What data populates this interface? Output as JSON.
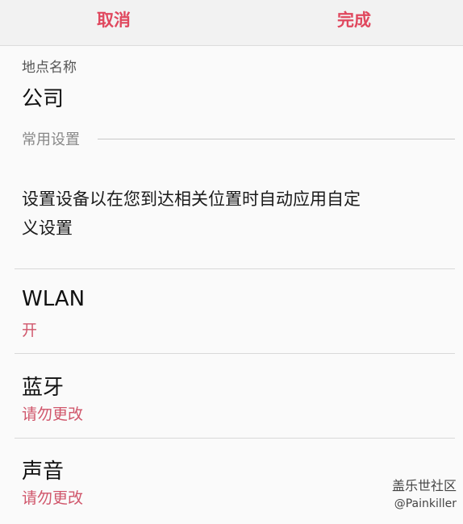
{
  "topbar": {
    "cancel_label": "取消",
    "done_label": "完成"
  },
  "location": {
    "label": "地点名称",
    "value": "公司"
  },
  "section": {
    "title": "常用设置"
  },
  "description": "设置设备以在您到达相关位置时自动应用自定义设置",
  "rows": [
    {
      "title": "WLAN",
      "status": "开"
    },
    {
      "title": "蓝牙",
      "status": "请勿更改"
    },
    {
      "title": "声音",
      "status": "请勿更改"
    }
  ],
  "watermark": {
    "line1": "盖乐世社区",
    "line2": "@Painkiller"
  },
  "colors": {
    "accent": "#e0485e",
    "status": "#d0566b"
  }
}
